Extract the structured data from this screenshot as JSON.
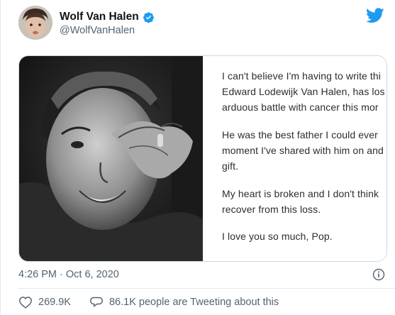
{
  "tweet": {
    "display_name": "Wolf Van Halen",
    "handle": "@WolfVanHalen",
    "timestamp": "4:26 PM · Oct 6, 2020",
    "note_lines": [
      "I can't believe I'm having to write thi",
      "Edward Lodewijk Van Halen, has los",
      "arduous battle with cancer this mor",
      "He was the best father I could ever",
      "moment I've shared with him on and",
      "gift.",
      "My heart is broken and I don't think",
      "recover from this loss.",
      "I love you so much, Pop."
    ],
    "likes_count": "269.9K",
    "tweeting_about": "86.1K people are Tweeting about this"
  },
  "icons": {
    "brand": "twitter-bird-icon",
    "verified": "verified-badge-icon",
    "info": "info-icon",
    "like": "heart-icon",
    "reply": "speech-bubble-icon"
  },
  "colors": {
    "brand_blue": "#1d9bf0",
    "secondary_text": "#536471",
    "primary_text": "#0f1419"
  }
}
